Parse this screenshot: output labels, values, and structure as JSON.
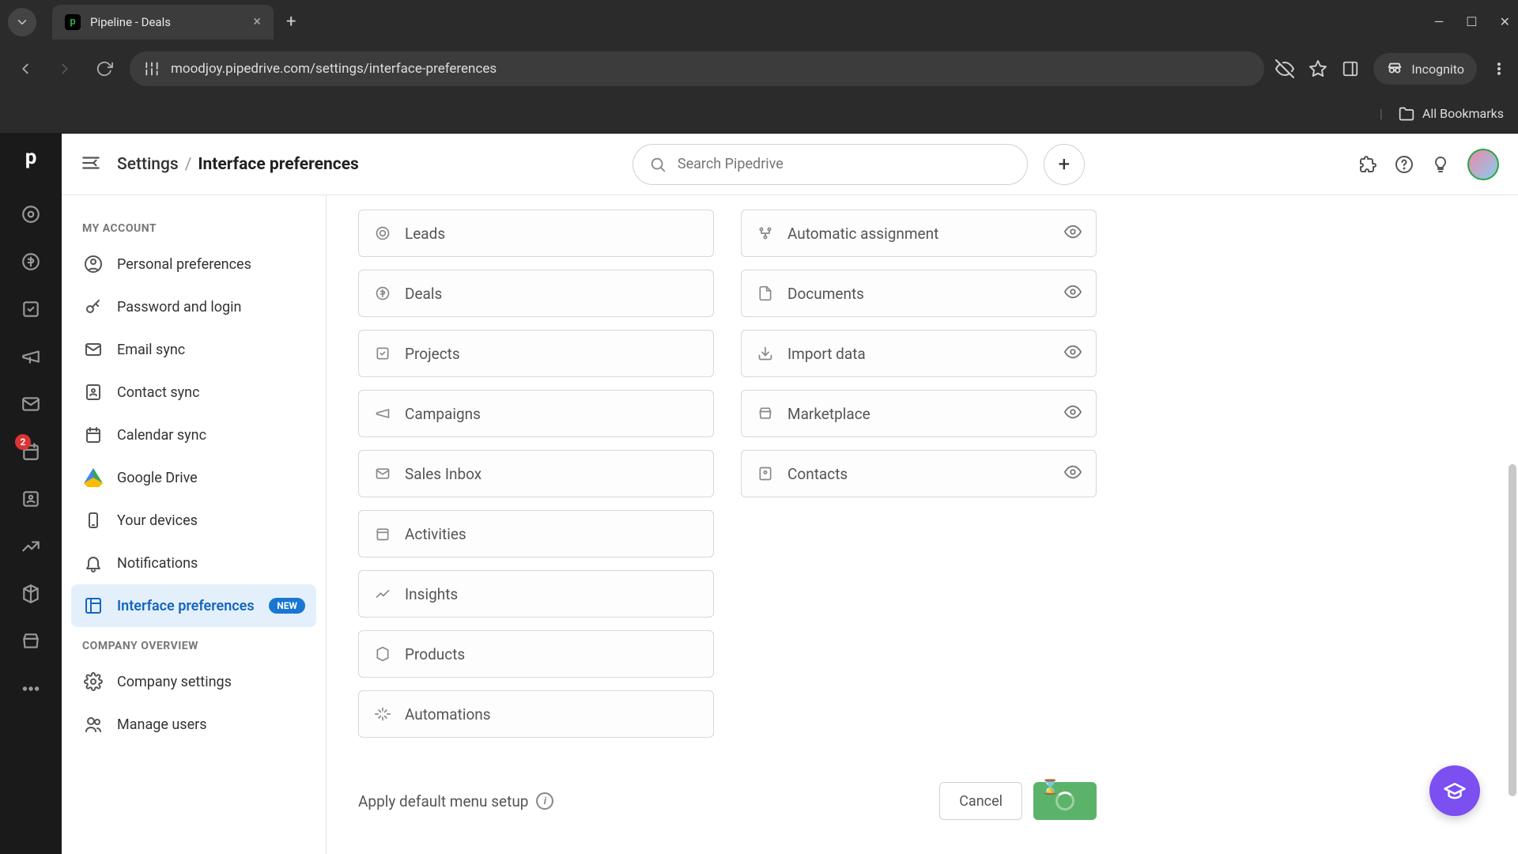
{
  "browser": {
    "tab_title": "Pipeline - Deals",
    "url": "moodjoy.pipedrive.com/settings/interface-preferences",
    "incognito_label": "Incognito",
    "all_bookmarks": "All Bookmarks"
  },
  "rail": {
    "badge_count": "2"
  },
  "header": {
    "breadcrumb_root": "Settings",
    "breadcrumb_current": "Interface preferences",
    "search_placeholder": "Search Pipedrive"
  },
  "sidebar": {
    "section1_title": "MY ACCOUNT",
    "items1": [
      {
        "label": "Personal preferences"
      },
      {
        "label": "Password and login"
      },
      {
        "label": "Email sync"
      },
      {
        "label": "Contact sync"
      },
      {
        "label": "Calendar sync"
      },
      {
        "label": "Google Drive"
      },
      {
        "label": "Your devices"
      },
      {
        "label": "Notifications"
      },
      {
        "label": "Interface preferences",
        "active": true,
        "badge": "NEW"
      }
    ],
    "section2_title": "COMPANY OVERVIEW",
    "items2": [
      {
        "label": "Company settings"
      },
      {
        "label": "Manage users"
      }
    ]
  },
  "tiles": {
    "left": [
      {
        "label": "Leads"
      },
      {
        "label": "Deals"
      },
      {
        "label": "Projects"
      },
      {
        "label": "Campaigns"
      },
      {
        "label": "Sales Inbox"
      },
      {
        "label": "Activities"
      },
      {
        "label": "Insights"
      },
      {
        "label": "Products"
      },
      {
        "label": "Automations"
      }
    ],
    "right": [
      {
        "label": "Automatic assignment"
      },
      {
        "label": "Documents"
      },
      {
        "label": "Import data"
      },
      {
        "label": "Marketplace"
      },
      {
        "label": "Contacts"
      }
    ]
  },
  "footer": {
    "apply_default": "Apply default menu setup",
    "cancel": "Cancel"
  }
}
